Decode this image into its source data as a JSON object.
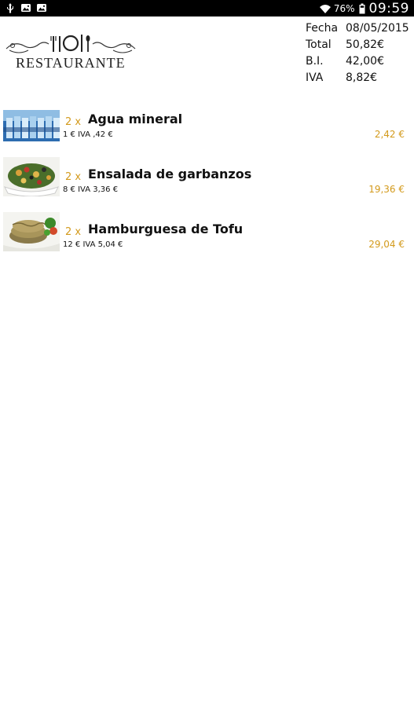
{
  "status_bar": {
    "left_icons": [
      "usb-icon",
      "image-icon",
      "image-icon"
    ],
    "wifi_icon": "wifi-icon",
    "battery_percent": "76%",
    "battery_icon": "battery-icon",
    "clock": "09:59"
  },
  "header": {
    "logo_text": "RESTAURANTE",
    "summary": [
      {
        "label": "Fecha",
        "value": "08/05/2015"
      },
      {
        "label": "Total",
        "value": "50,82€"
      },
      {
        "label": "B.I.",
        "value": "42,00€"
      },
      {
        "label": "IVA",
        "value": "8,82€"
      }
    ]
  },
  "items": [
    {
      "qty": "2 x",
      "name": "Agua mineral",
      "detail": "1 € IVA ,42 €",
      "price": "2,42 €"
    },
    {
      "qty": "2 x",
      "name": "Ensalada de garbanzos",
      "detail": "8 € IVA 3,36 €",
      "price": "19,36 €"
    },
    {
      "qty": "2 x",
      "name": "Hamburguesa de Tofu",
      "detail": "12 € IVA 5,04 €",
      "price": "29,04 €"
    }
  ],
  "colors": {
    "accent": "#d39a1c",
    "status_bar": "#000000",
    "background": "#ffffff"
  }
}
